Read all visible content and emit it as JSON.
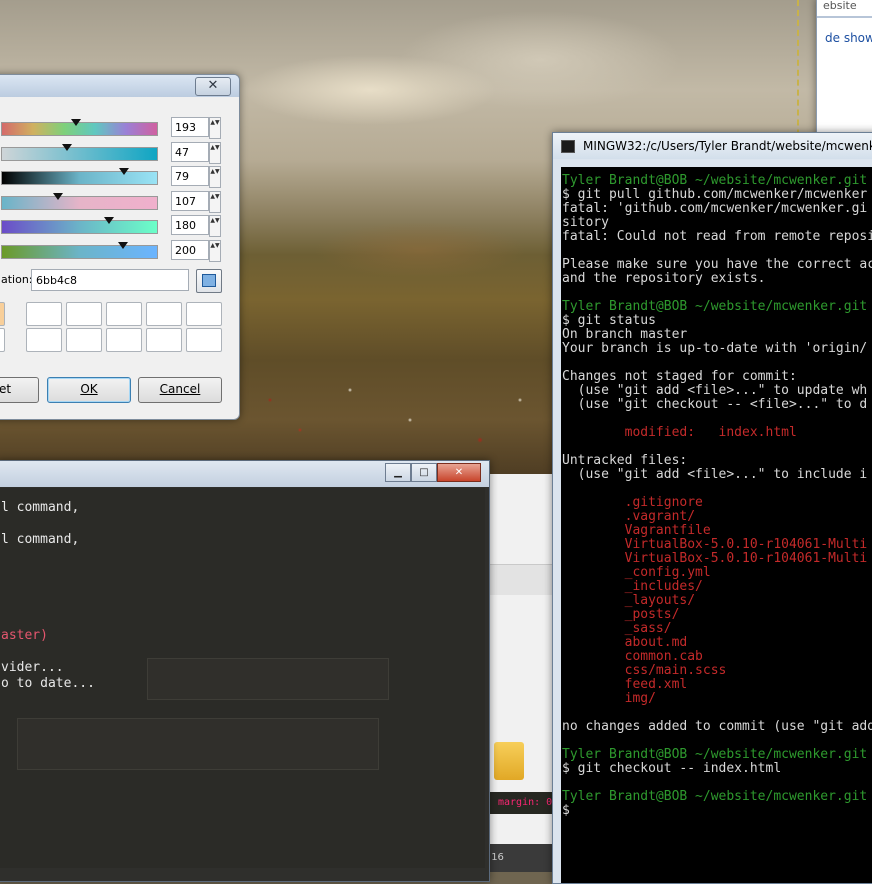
{
  "browser": {
    "bookmark": "ebsite",
    "link": "de show"
  },
  "color_dialog": {
    "close": "✕",
    "sliders": [
      {
        "value": "193",
        "thumb": 0.48,
        "gradient": "linear-gradient(90deg,#d46a6a,#d0b060,#7fd07a,#60c8c0,#9a80d6,#d060a0)"
      },
      {
        "value": "47",
        "thumb": 0.42,
        "gradient": "linear-gradient(90deg,#cfd5d8,#0fa5c3)"
      },
      {
        "value": "79",
        "thumb": 0.79,
        "gradient": "linear-gradient(90deg,#000000,#6bb4c8,#9ae3f5)"
      },
      {
        "value": "107",
        "thumb": 0.36,
        "gradient": "linear-gradient(90deg,#69b4c8,#e6b4c8,#f0b0cc)"
      },
      {
        "value": "180",
        "thumb": 0.69,
        "gradient": "linear-gradient(90deg,#6b4cc8,#6bb4c8,#6bffc8)"
      },
      {
        "value": "200",
        "thumb": 0.78,
        "gradient": "linear-gradient(90deg,#6b9a28,#6bb4c8,#6bb4ff)"
      }
    ],
    "hex_label": "ation:",
    "hex_value": "6bb4c8",
    "swatch_accent": "#f8cf9a",
    "buttons": {
      "reset": "et",
      "ok": "OK",
      "cancel": "Cancel"
    }
  },
  "console": {
    "controls": {
      "min": "▁",
      "max": "□",
      "close": "✕"
    },
    "lines": [
      {
        "text": "l command,",
        "color": "#e8e8e8"
      },
      {
        "text": "l command,",
        "color": "#e8e8e8"
      },
      {
        "text": "aster)",
        "color": "#e5566e"
      },
      {
        "text": "vider...",
        "color": "#e8e8e8"
      },
      {
        "text": "o to date...",
        "color": "#e8e8e8"
      }
    ]
  },
  "behind": {
    "margin_text": "margin: 0",
    "page_number": "16"
  },
  "terminal": {
    "title": "MINGW32:/c/Users/Tyler Brandt/website/mcwenker.gi",
    "lines": [
      {
        "text": "Tyler Brandt@BOB ~/website/mcwenker.git",
        "cls": "g"
      },
      {
        "text": "$ git pull github.com/mcwenker/mcwenker",
        "cls": "w"
      },
      {
        "text": "fatal: 'github.com/mcwenker/mcwenker.gi",
        "cls": "w"
      },
      {
        "text": "sitory",
        "cls": "w"
      },
      {
        "text": "fatal: Could not read from remote reposi",
        "cls": "w"
      },
      {
        "text": "",
        "cls": "w"
      },
      {
        "text": "Please make sure you have the correct ac",
        "cls": "w"
      },
      {
        "text": "and the repository exists.",
        "cls": "w"
      },
      {
        "text": "",
        "cls": "w"
      },
      {
        "text": "Tyler Brandt@BOB ~/website/mcwenker.git",
        "cls": "g"
      },
      {
        "text": "$ git status",
        "cls": "w"
      },
      {
        "text": "On branch master",
        "cls": "w"
      },
      {
        "text": "Your branch is up-to-date with 'origin/",
        "cls": "w"
      },
      {
        "text": "",
        "cls": "w"
      },
      {
        "text": "Changes not staged for commit:",
        "cls": "w"
      },
      {
        "text": "  (use \"git add <file>...\" to update wh",
        "cls": "w"
      },
      {
        "text": "  (use \"git checkout -- <file>...\" to d",
        "cls": "w"
      },
      {
        "text": "",
        "cls": "w"
      },
      {
        "text": "        modified:   index.html",
        "cls": "r"
      },
      {
        "text": "",
        "cls": "w"
      },
      {
        "text": "Untracked files:",
        "cls": "w"
      },
      {
        "text": "  (use \"git add <file>...\" to include i",
        "cls": "w"
      },
      {
        "text": "",
        "cls": "w"
      },
      {
        "text": "        .gitignore",
        "cls": "r"
      },
      {
        "text": "        .vagrant/",
        "cls": "r"
      },
      {
        "text": "        Vagrantfile",
        "cls": "r"
      },
      {
        "text": "        VirtualBox-5.0.10-r104061-Multi",
        "cls": "r"
      },
      {
        "text": "        VirtualBox-5.0.10-r104061-Multi",
        "cls": "r"
      },
      {
        "text": "        _config.yml",
        "cls": "r"
      },
      {
        "text": "        _includes/",
        "cls": "r"
      },
      {
        "text": "        _layouts/",
        "cls": "r"
      },
      {
        "text": "        _posts/",
        "cls": "r"
      },
      {
        "text": "        _sass/",
        "cls": "r"
      },
      {
        "text": "        about.md",
        "cls": "r"
      },
      {
        "text": "        common.cab",
        "cls": "r"
      },
      {
        "text": "        css/main.scss",
        "cls": "r"
      },
      {
        "text": "        feed.xml",
        "cls": "r"
      },
      {
        "text": "        img/",
        "cls": "r"
      },
      {
        "text": "",
        "cls": "w"
      },
      {
        "text": "no changes added to commit (use \"git add",
        "cls": "w"
      },
      {
        "text": "",
        "cls": "w"
      },
      {
        "text": "Tyler Brandt@BOB ~/website/mcwenker.git",
        "cls": "g"
      },
      {
        "text": "$ git checkout -- index.html",
        "cls": "w"
      },
      {
        "text": "",
        "cls": "w"
      },
      {
        "text": "Tyler Brandt@BOB ~/website/mcwenker.git",
        "cls": "g"
      },
      {
        "text": "$",
        "cls": "w"
      }
    ]
  }
}
